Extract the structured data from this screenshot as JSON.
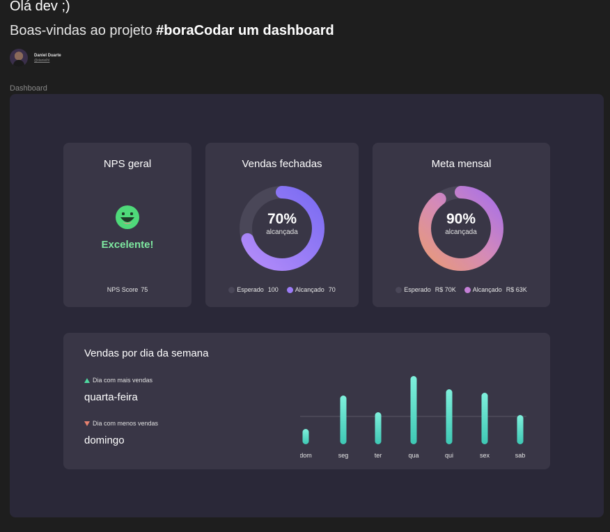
{
  "header": {
    "greeting": "Olá dev ;)",
    "subtitle_prefix": "Boas-vindas ao projeto ",
    "subtitle_bold": "#boraCodar um dashboard",
    "author_name": "Daniel Duarte",
    "author_handle": "@danielhl"
  },
  "dashboard_label": "Dashboard",
  "nps": {
    "title": "NPS geral",
    "status": "Excelente!",
    "score_label": "NPS Score",
    "score_value": "75",
    "icon": "smile-icon",
    "status_color": "#7ee8a0"
  },
  "sales": {
    "title": "Vendas fechadas",
    "percent_label": "70%",
    "percent": 70,
    "sub": "alcançada",
    "legend_expected_label": "Esperado",
    "legend_expected_value": "100",
    "legend_achieved_label": "Alcançado",
    "legend_achieved_value": "70",
    "color_expected": "#4a4758",
    "color_achieved": "#9b7bf7"
  },
  "meta": {
    "title": "Meta mensal",
    "percent_label": "90%",
    "percent": 90,
    "sub": "alcançada",
    "legend_expected_label": "Esperado",
    "legend_expected_value": "R$ 70K",
    "legend_achieved_label": "Alcançado",
    "legend_achieved_value": "R$ 63K",
    "color_expected": "#4a4758",
    "color_achieved": "#c47fd6"
  },
  "weekly": {
    "title": "Vendas por dia da semana",
    "best_label": "Dia com mais vendas",
    "best_value": "quarta-feira",
    "worst_label": "Dia com menos vendas",
    "worst_value": "domingo",
    "up_color": "#4fd9a0",
    "down_color": "#e8826f"
  },
  "chart_data": {
    "type": "bar",
    "categories": [
      "dom",
      "seg",
      "ter",
      "qua",
      "qui",
      "sex",
      "sab"
    ],
    "values": [
      22,
      70,
      46,
      98,
      79,
      74,
      42
    ],
    "reference_line": 40,
    "ylim": [
      0,
      100
    ],
    "bar_color": "#4fd9c4"
  }
}
